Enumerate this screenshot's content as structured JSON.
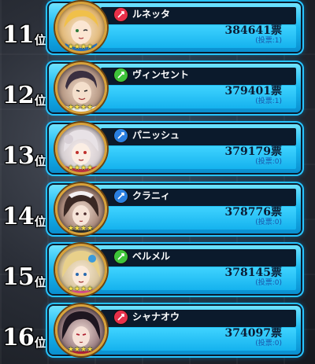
{
  "rank_suffix": "位",
  "vote_unit": "票",
  "entries": [
    {
      "rank": "11",
      "name": "ルネッタ",
      "votes": "384641",
      "sub": "(投票:1)",
      "attr": "fire",
      "attr_color": "#e8304a",
      "stars": "★★★★"
    },
    {
      "rank": "12",
      "name": "ヴィンセント",
      "votes": "379401",
      "sub": "(投票:1)",
      "attr": "wind",
      "attr_color": "#3ec43a",
      "stars": "★★★★"
    },
    {
      "rank": "13",
      "name": "パニッシュ",
      "votes": "379179",
      "sub": "(投票:0)",
      "attr": "water",
      "attr_color": "#2a7fe0",
      "stars": "★★★★"
    },
    {
      "rank": "14",
      "name": "クラニィ",
      "votes": "378776",
      "sub": "(投票:0)",
      "attr": "water",
      "attr_color": "#2a7fe0",
      "stars": "★★★★"
    },
    {
      "rank": "15",
      "name": "ベルメル",
      "votes": "378145",
      "sub": "(投票:0)",
      "attr": "wind",
      "attr_color": "#3ec43a",
      "stars": "★★★★"
    },
    {
      "rank": "16",
      "name": "シャナオウ",
      "votes": "374097",
      "sub": "(投票:0)",
      "attr": "fire",
      "attr_color": "#e8304a",
      "stars": "★★★★"
    }
  ]
}
